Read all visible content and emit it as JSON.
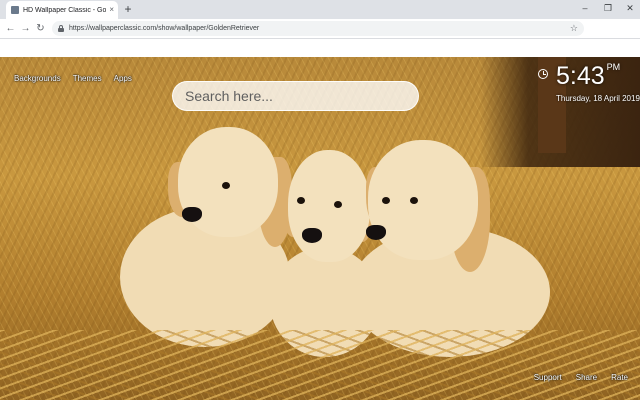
{
  "browser": {
    "tab": {
      "title": "HD Wallpaper Classic - GoldenRe",
      "close": "×",
      "favicon": "wallpaper-favicon-icon"
    },
    "new_tab": "+",
    "window_controls": {
      "minimize": "–",
      "restore": "❐",
      "close": "✕"
    },
    "nav": {
      "back": "←",
      "forward": "→",
      "reload": "↻"
    },
    "url": "https://wallpaperclassic.com/show/wallpaper/GoldenRetriever",
    "bookmark_star": "☆"
  },
  "page": {
    "top_nav": [
      "Backgrounds",
      "Themes",
      "Apps"
    ],
    "search": {
      "placeholder": "Search here..."
    },
    "clock": {
      "time": "5:43",
      "ampm": "PM",
      "date": "Thursday, 18 April 2019"
    },
    "bottom_nav": [
      "Support",
      "Share",
      "Rate"
    ]
  },
  "colors": {
    "tabstrip": "#dee1e6",
    "hay": "#c9983f",
    "text_light": "#ffffff"
  }
}
